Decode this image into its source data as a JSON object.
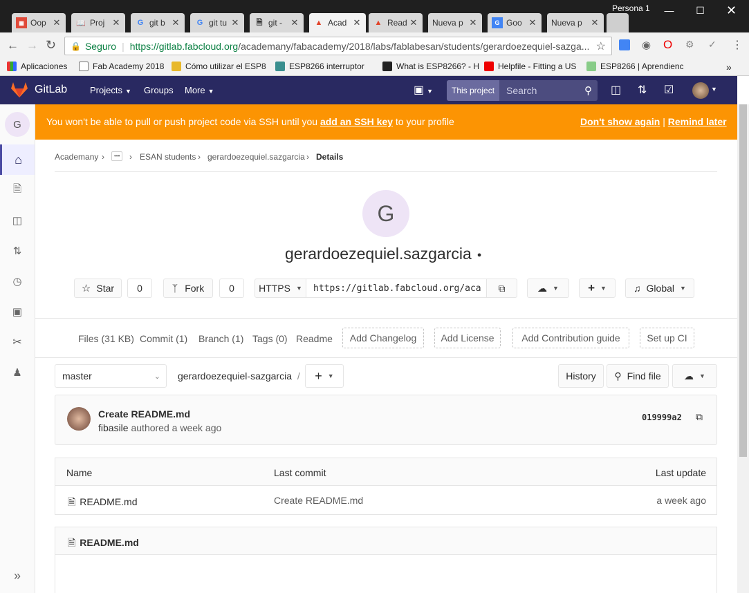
{
  "browser": {
    "profile": "Persona 1",
    "tabs": [
      {
        "title": "Oop"
      },
      {
        "title": "Proj"
      },
      {
        "title": "git b"
      },
      {
        "title": "git tu"
      },
      {
        "title": "git -"
      },
      {
        "title": "Acad"
      },
      {
        "title": "Read"
      },
      {
        "title": "Nueva p"
      },
      {
        "title": "Goo"
      },
      {
        "title": "Nueva p"
      }
    ],
    "secure_label": "Seguro",
    "url_host": "https://gitlab.fabcloud.org",
    "url_path": "/academany/fabacademy/2018/labs/fablabesan/students/gerardoezequiel-sazga...",
    "bookmarks": [
      {
        "label": "Aplicaciones"
      },
      {
        "label": "Fab Academy 2018"
      },
      {
        "label": "Cómo utilizar el ESP8"
      },
      {
        "label": "ESP8266 interruptor"
      },
      {
        "label": "What is ESP8266? - H"
      },
      {
        "label": "Helpfile - Fitting a US"
      },
      {
        "label": "ESP8266 | Aprendienc"
      }
    ]
  },
  "nav": {
    "brand": "GitLab",
    "projects": "Projects",
    "groups": "Groups",
    "more": "More",
    "scope": "This project",
    "search_placeholder": "Search"
  },
  "sidebar": {
    "avatar_letter": "G"
  },
  "banner": {
    "text_before": "You won't be able to pull or push project code via SSH until you ",
    "link": "add an SSH key",
    "text_after": " to your profile",
    "dont_show": "Don't show again",
    "sep": "|",
    "remind": "Remind later"
  },
  "breadcrumb": {
    "root": "Academany",
    "ellipsis": "•••",
    "group": "ESAN students",
    "project": "gerardoezequiel.sazgarcia",
    "current": "Details"
  },
  "project": {
    "avatar_letter": "G",
    "name": "gerardoezequiel.sazgarcia",
    "star_label": "Star",
    "star_count": "0",
    "fork_label": "Fork",
    "fork_count": "0",
    "protocol": "HTTPS",
    "clone_url": "https://gitlab.fabcloud.org/aca",
    "notify_label": "Global"
  },
  "stats": {
    "files": "Files (31 KB)",
    "commit": "Commit (1)",
    "branch": "Branch (1)",
    "tags": "Tags (0)",
    "readme": "Readme",
    "add_changelog": "Add Changelog",
    "add_license": "Add License",
    "add_contrib": "Add Contribution guide",
    "setup_ci": "Set up CI"
  },
  "tree": {
    "branch": "master",
    "path": "gerardoezequiel-sazgarcia",
    "path_sep": "/",
    "history": "History",
    "find_file": "Find file"
  },
  "commit": {
    "title": "Create README.md",
    "author": "fibasile",
    "authored": "authored",
    "when": "a week ago",
    "sha": "019999a2"
  },
  "files_table": {
    "headers": {
      "name": "Name",
      "last_commit": "Last commit",
      "last_update": "Last update"
    },
    "rows": [
      {
        "name": "README.md",
        "last_commit": "Create README.md",
        "last_update": "a week ago"
      }
    ]
  },
  "readme": {
    "title": "README.md"
  },
  "colors": {
    "nav_bg": "#292961",
    "banner_bg": "#fc9403",
    "avatar_bg": "#eee4f6",
    "chrome_bg": "#f2f2f2"
  }
}
